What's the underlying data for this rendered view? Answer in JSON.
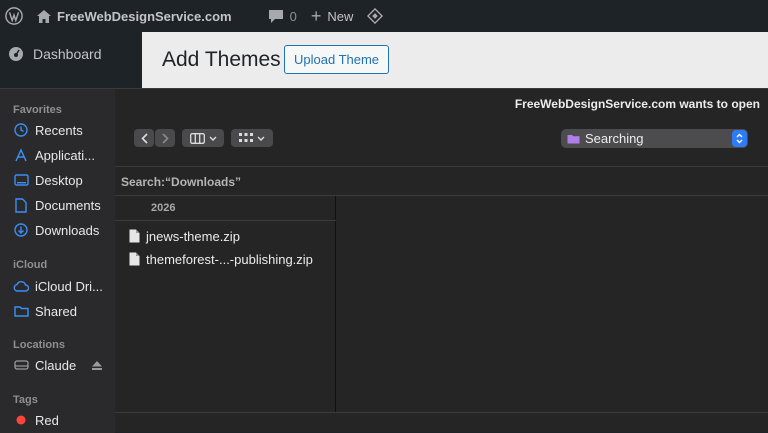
{
  "admin_bar": {
    "site_name": "FreeWebDesignService.com",
    "comments_count": "0",
    "new_label": "New"
  },
  "wp_sidebar": {
    "dashboard_label": "Dashboard"
  },
  "wp_page": {
    "title": "Add Themes",
    "upload_button": "Upload Theme"
  },
  "dialog": {
    "title": "FreeWebDesignService.com wants to open",
    "location_popup": "Searching",
    "search_label": "Search:“Downloads”",
    "column_header": "2026",
    "files": [
      {
        "name": "jnews-theme.zip",
        "icon": "document-icon"
      },
      {
        "name": "themeforest-...-publishing.zip",
        "icon": "document-icon"
      }
    ],
    "sidebar": {
      "favorites_heading": "Favorites",
      "favorites": [
        {
          "label": "Recents",
          "icon": "clock-icon"
        },
        {
          "label": "Applicati...",
          "icon": "applications-icon"
        },
        {
          "label": "Desktop",
          "icon": "desktop-icon"
        },
        {
          "label": "Documents",
          "icon": "document-icon"
        },
        {
          "label": "Downloads",
          "icon": "download-icon"
        }
      ],
      "icloud_heading": "iCloud",
      "icloud": [
        {
          "label": "iCloud Dri...",
          "icon": "cloud-icon"
        },
        {
          "label": "Shared",
          "icon": "shared-folder-icon"
        }
      ],
      "locations_heading": "Locations",
      "locations": [
        {
          "label": "Claude",
          "icon": "disk-icon"
        }
      ],
      "tags_heading": "Tags",
      "tags": [
        {
          "label": "Red",
          "color": "#ff453a"
        }
      ]
    }
  },
  "colors": {
    "accent": "#2f7bf5",
    "sidebar_icon": "#3b8ef3",
    "wp_link": "#2271b1"
  }
}
